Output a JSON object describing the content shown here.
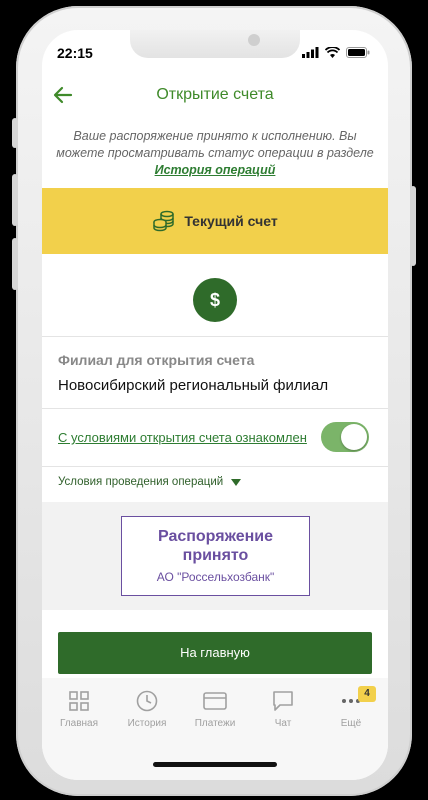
{
  "status_bar": {
    "time": "22:15"
  },
  "header": {
    "title": "Открытие счета"
  },
  "notice": {
    "text": "Ваше распоряжение принято к исполнению. Вы можете просматривать статус операции в разделе",
    "link": "История операций"
  },
  "account": {
    "label": "Текущий счет",
    "currency_symbol": "$"
  },
  "branch": {
    "label": "Филиал для открытия счета",
    "value": "Новосибирский региональный филиал"
  },
  "terms": {
    "label": "С условиями открытия счета ознакомлен",
    "accepted": true
  },
  "conditions": {
    "label": "Условия проведения операций"
  },
  "stamp": {
    "line1": "Распоряжение",
    "line2": "принято",
    "org": "АО \"Россельхозбанк\""
  },
  "main_button": {
    "label": "На главную"
  },
  "tabs": [
    {
      "label": "Главная",
      "icon": "grid-icon"
    },
    {
      "label": "История",
      "icon": "clock-icon"
    },
    {
      "label": "Платежи",
      "icon": "card-icon"
    },
    {
      "label": "Чат",
      "icon": "chat-icon"
    },
    {
      "label": "Ещё",
      "icon": "more-icon",
      "badge": "4"
    }
  ],
  "colors": {
    "accent_green": "#2f6b2a",
    "yellow": "#f2d04b",
    "stamp_purple": "#6a4fa0"
  }
}
